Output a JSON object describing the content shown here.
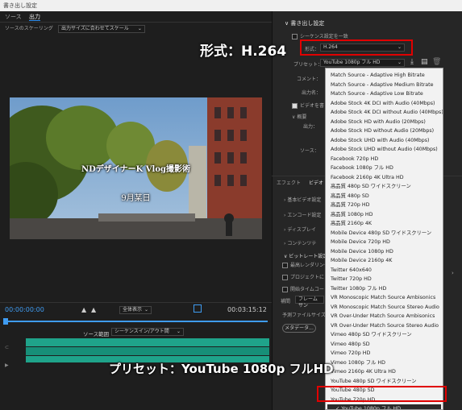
{
  "window": {
    "title": "書き出し設定"
  },
  "left_tabs": [
    "ソース",
    "出力"
  ],
  "scaling": {
    "label": "ソースのスケーリング",
    "value": "出力サイズに合わせてスケール"
  },
  "video": {
    "caption_top": "NDデザイナーK Vlog撮影術",
    "caption_bottom": "9月某日"
  },
  "playback": {
    "timecode_current": "00:00:00:00",
    "timecode_end": "00:03:15:12",
    "fit_label": "全体表示",
    "source_range_label": "ソース範囲",
    "source_range_value": "シーケンスイン/アウト間"
  },
  "export_settings": {
    "section": "書き出し設定",
    "match_sequence": "シーケンス設定を一致",
    "format_label": "形式：",
    "format_value": "H.264",
    "preset_label": "プリセット：",
    "preset_value": "YouTube 1080p フル HD",
    "comment_label": "コメント：",
    "output_name_label": "出力名："
  },
  "right_tabs": [
    "エフェクト",
    "ビデオ"
  ],
  "right_sections": [
    "基本ビデオ設定",
    "エンコード設定",
    "ディスプレイ",
    "コンテンツテ",
    "ビットレート設定"
  ],
  "right_checks": [
    "最高レンダリング",
    "プロジェクトに",
    "開始タイムコード"
  ],
  "interpolation_label": "補間",
  "interpolation_value": "フレームサン",
  "estimated_size_label": "予測ファイルサイズ：",
  "metadata_button": "メタデータ...",
  "summary": {
    "title": "概要",
    "output_label": "出力：",
    "source_label": "ソース："
  },
  "preset_options": [
    "Match Source - Adaptive High Bitrate",
    "Match Source - Adaptive Medium Bitrate",
    "Match Source - Adaptive Low Bitrate",
    "Adobe Stock 4K DCI with Audio (40Mbps)",
    "Adobe Stock 4K DCI without Audio (40Mbps)",
    "Adobe Stock HD with Audio (20Mbps)",
    "Adobe Stock HD without Audio (20Mbps)",
    "Adobe Stock UHD with Audio (40Mbps)",
    "Adobe Stock UHD without Audio (40Mbps)",
    "Facebook 720p HD",
    "Facebook  1080p フル HD",
    "Facebook 2160p 4K Ultra HD",
    "高品質  480p SD ワイドスクリーン",
    "高品質  480p SD",
    "高品質  720p HD",
    "高品質  1080p HD",
    "高品質  2160p 4K",
    "Mobile Device 480p SD ワイドスクリーン",
    "Mobile Device 720p HD",
    "Mobile Device 1080p HD",
    "Mobile Device 2160p 4K",
    "Twitter 640x640",
    "Twitter 720p HD",
    "Twitter  1080p フル HD",
    "VR Monoscopic Match Source Ambisonics",
    "VR Monoscopic Match Source Stereo Audio",
    "VR Over-Under Match Source Ambisonics",
    "VR Over-Under Match Source Stereo Audio",
    "Vimeo 480p SD ワイドスクリーン",
    "Vimeo 480p SD",
    "Vimeo 720p HD",
    "Vimeo  1080p フル HD",
    "Vimeo 2160p 4K Ultra HD",
    "YouTube 480p SD ワイドスクリーン",
    "YouTube 480p SD",
    "YouTube 720p HD",
    "YouTube  1080p フル HD"
  ],
  "selected_preset": "YouTube  1080p フル HD",
  "annotations": {
    "format": "形式：H.264",
    "preset": "プリセット：YouTube 1080p フルHD"
  },
  "colors": {
    "accent": "#2d8ceb",
    "highlight_red": "#e00000",
    "waveform": "#1fa38a"
  }
}
